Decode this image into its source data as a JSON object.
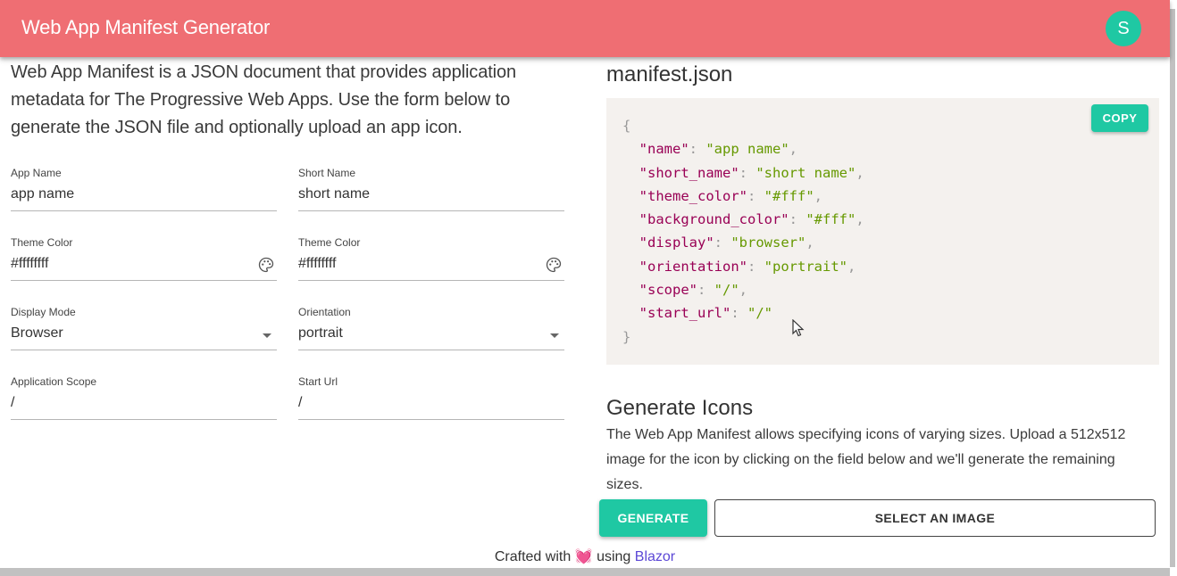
{
  "header": {
    "title": "Web App Manifest Generator",
    "avatar_initial": "S",
    "accent_color": "#ef6e73",
    "primary_color": "#1fc8a3"
  },
  "intro": "Web App Manifest is a JSON document that provides application metadata for The Progressive Web Apps. Use the form below to generate the JSON file and optionally upload an app icon.",
  "form": {
    "app_name": {
      "label": "App Name",
      "value": "app name"
    },
    "short_name": {
      "label": "Short Name",
      "value": "short name"
    },
    "theme_color": {
      "label": "Theme Color",
      "value": "#ffffffff",
      "icon": "palette-icon"
    },
    "background_color": {
      "label": "Theme Color",
      "value": "#ffffffff",
      "icon": "palette-icon"
    },
    "display_mode": {
      "label": "Display Mode",
      "value": "Browser",
      "icon": "dropdown-caret"
    },
    "orientation": {
      "label": "Orientation",
      "value": "portrait",
      "icon": "dropdown-caret"
    },
    "scope": {
      "label": "Application Scope",
      "value": "/"
    },
    "start_url": {
      "label": "Start Url",
      "value": "/"
    }
  },
  "manifest": {
    "title": "manifest.json",
    "copy_label": "COPY",
    "open_brace": "{",
    "close_brace": "}",
    "entries": [
      {
        "key": "\"name\"",
        "value": "\"app name\"",
        "comma": ","
      },
      {
        "key": "\"short_name\"",
        "value": "\"short name\"",
        "comma": ","
      },
      {
        "key": "\"theme_color\"",
        "value": "\"#fff\"",
        "comma": ","
      },
      {
        "key": "\"background_color\"",
        "value": "\"#fff\"",
        "comma": ","
      },
      {
        "key": "\"display\"",
        "value": "\"browser\"",
        "comma": ","
      },
      {
        "key": "\"orientation\"",
        "value": "\"portrait\"",
        "comma": ","
      },
      {
        "key": "\"scope\"",
        "value": "\"/\"",
        "comma": ","
      },
      {
        "key": "\"start_url\"",
        "value": "\"/\"",
        "comma": ""
      }
    ]
  },
  "icons": {
    "title": "Generate Icons",
    "description": "The Web App Manifest allows specifying icons of varying sizes. Upload a 512x512 image for the icon by clicking on the field below and we'll generate the remaining sizes.",
    "generate_label": "GENERATE",
    "select_label": "SELECT AN IMAGE"
  },
  "footer": {
    "prefix": "Crafted with",
    "heart": "💓",
    "middle": "using",
    "link": "Blazor"
  }
}
